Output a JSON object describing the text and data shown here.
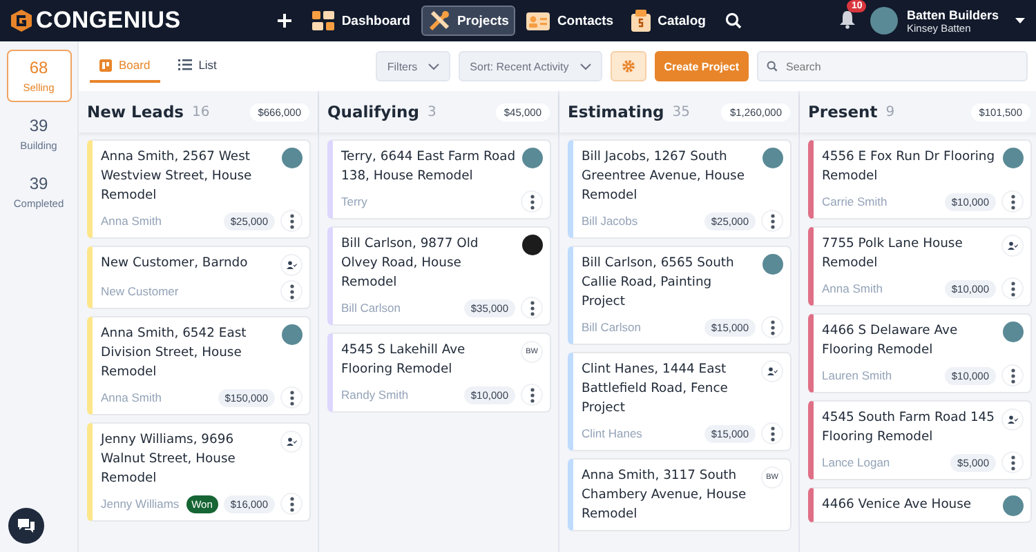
{
  "brand": "CONGENIUS",
  "nav": [
    {
      "label": "Dashboard",
      "kind": "dashboard",
      "selected": false
    },
    {
      "label": "Projects",
      "kind": "projects",
      "selected": true
    },
    {
      "label": "Contacts",
      "kind": "contacts",
      "selected": false
    },
    {
      "label": "Catalog",
      "kind": "catalog",
      "selected": false
    }
  ],
  "notifications": {
    "count": "10"
  },
  "account": {
    "company": "Batten Builders",
    "user": "Kinsey Batten"
  },
  "stages": [
    {
      "count": "68",
      "label": "Selling",
      "selected": true
    },
    {
      "count": "39",
      "label": "Building",
      "selected": false
    },
    {
      "count": "39",
      "label": "Completed",
      "selected": false
    }
  ],
  "view_tabs": [
    {
      "label": "Board",
      "kind": "board",
      "selected": true
    },
    {
      "label": "List",
      "kind": "list",
      "selected": false
    }
  ],
  "filters": "Filters",
  "sort": "Sort: Recent Activity",
  "create_button": "Create Project",
  "search": {
    "placeholder": "Search"
  },
  "columns": [
    {
      "name": "New Leads",
      "count": "16",
      "total": "$666,000",
      "color": "#fde68a",
      "cards": [
        {
          "title": "Anna Smith, 2567 West Westview Street, House Remodel",
          "contact": "Anna Smith",
          "amount": "$25,000",
          "assignee": {
            "kind": "photo"
          }
        },
        {
          "title": "New Customer, Barndo",
          "contact": "New Customer",
          "assignee": {
            "kind": "assign"
          }
        },
        {
          "title": "Anna Smith, 6542 East Division Street, House Remodel",
          "contact": "Anna Smith",
          "amount": "$150,000",
          "assignee": {
            "kind": "photo"
          }
        },
        {
          "title": "Jenny Williams, 9696 Walnut Street, House Remodel",
          "contact": "Jenny Williams",
          "amount": "$16,000",
          "won": "Won",
          "assignee": {
            "kind": "assign"
          }
        }
      ]
    },
    {
      "name": "Qualifying",
      "count": "3",
      "total": "$45,000",
      "color": "#ddd6fe",
      "cards": [
        {
          "title": "Terry, 6644 East Farm Road 138, House Remodel",
          "contact": "Terry",
          "assignee": {
            "kind": "photo"
          }
        },
        {
          "title": "Bill Carlson, 9877 Old Olvey Road, House Remodel",
          "contact": "Bill Carlson",
          "amount": "$35,000",
          "assignee": {
            "kind": "dark"
          }
        },
        {
          "title": "4545 S Lakehill Ave Flooring Remodel",
          "contact": "Randy Smith",
          "amount": "$10,000",
          "assignee": {
            "kind": "initials",
            "initials": "BW"
          }
        }
      ]
    },
    {
      "name": "Estimating",
      "count": "35",
      "total": "$1,260,000",
      "color": "#bfdbfe",
      "cards": [
        {
          "title": "Bill Jacobs, 1267 South Greentree Avenue, House Remodel",
          "contact": "Bill Jacobs",
          "amount": "$25,000",
          "assignee": {
            "kind": "photo"
          }
        },
        {
          "title": "Bill Carlson, 6565 South Callie Road, Painting Project",
          "contact": "Bill Carlson",
          "amount": "$15,000",
          "assignee": {
            "kind": "photo"
          }
        },
        {
          "title": "Clint Hanes, 1444 East Battlefield Road, Fence Project",
          "contact": "Clint Hanes",
          "amount": "$15,000",
          "assignee": {
            "kind": "assign"
          }
        },
        {
          "title": "Anna Smith, 3117 South Chambery Avenue, House Remodel",
          "assignee": {
            "kind": "initials",
            "initials": "BW"
          }
        }
      ]
    },
    {
      "name": "Present",
      "count": "9",
      "total": "$101,500",
      "color": "#df6f86",
      "cards": [
        {
          "title": "4556 E Fox Run Dr Flooring Remodel",
          "contact": "Carrie Smith",
          "amount": "$10,000",
          "assignee": {
            "kind": "photo"
          }
        },
        {
          "title": "7755 Polk Lane House Remodel",
          "contact": "Anna Smith",
          "amount": "$10,000",
          "assignee": {
            "kind": "assign"
          }
        },
        {
          "title": "4466 S Delaware Ave Flooring Remodel",
          "contact": "Lauren Smith",
          "amount": "$10,000",
          "assignee": {
            "kind": "photo"
          }
        },
        {
          "title": "4545 South Farm Road 145 Flooring Remodel",
          "contact": "Lance Logan",
          "amount": "$5,000",
          "assignee": {
            "kind": "assign"
          }
        },
        {
          "title": "4466 Venice Ave House",
          "assignee": {
            "kind": "photo"
          }
        }
      ]
    }
  ]
}
